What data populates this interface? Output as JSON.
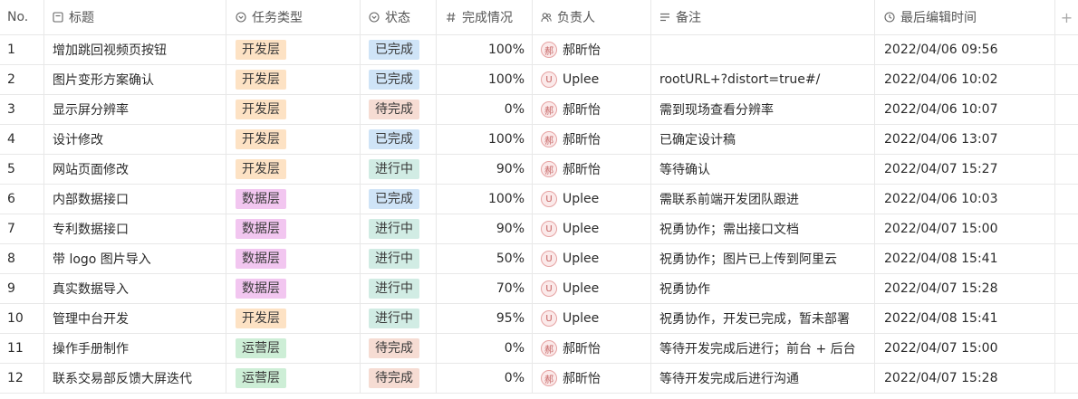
{
  "headers": {
    "no": "No.",
    "title": "标题",
    "type": "任务类型",
    "status": "状态",
    "progress": "完成情况",
    "owner": "负责人",
    "note": "备注",
    "time": "最后编辑时间",
    "add": "+"
  },
  "colors": {
    "dev_tag": "#fde2c4",
    "data_tag": "#f2c6f0",
    "ops_tag": "#cdeed6",
    "done_status": "#cfe4f7",
    "todo_status": "#f6dcd3",
    "progress_status": "#d1ece4"
  },
  "rows": [
    {
      "no": "1",
      "title": "增加跳回视频页按钮",
      "type": "开发层",
      "type_color": "#fde2c4",
      "status": "已完成",
      "status_color": "#cfe4f7",
      "progress": "100%",
      "avatar": "郝",
      "owner": "郝昕怡",
      "note": "",
      "time": "2022/04/06 09:56"
    },
    {
      "no": "2",
      "title": "图片变形方案确认",
      "type": "开发层",
      "type_color": "#fde2c4",
      "status": "已完成",
      "status_color": "#cfe4f7",
      "progress": "100%",
      "avatar": "U",
      "owner": "Uplee",
      "note": "rootURL+?distort=true#/",
      "time": "2022/04/06 10:02"
    },
    {
      "no": "3",
      "title": "显示屏分辨率",
      "type": "开发层",
      "type_color": "#fde2c4",
      "status": "待完成",
      "status_color": "#f6dcd3",
      "progress": "0%",
      "avatar": "郝",
      "owner": "郝昕怡",
      "note": "需到现场查看分辨率",
      "time": "2022/04/06 10:07"
    },
    {
      "no": "4",
      "title": "设计修改",
      "type": "开发层",
      "type_color": "#fde2c4",
      "status": "已完成",
      "status_color": "#cfe4f7",
      "progress": "100%",
      "avatar": "郝",
      "owner": "郝昕怡",
      "note": "已确定设计稿",
      "time": "2022/04/06 13:07"
    },
    {
      "no": "5",
      "title": "网站页面修改",
      "type": "开发层",
      "type_color": "#fde2c4",
      "status": "进行中",
      "status_color": "#d1ece4",
      "progress": "90%",
      "avatar": "郝",
      "owner": "郝昕怡",
      "note": "等待确认",
      "time": "2022/04/07 15:27"
    },
    {
      "no": "6",
      "title": "内部数据接口",
      "type": "数据层",
      "type_color": "#f2c6f0",
      "status": "已完成",
      "status_color": "#cfe4f7",
      "progress": "100%",
      "avatar": "U",
      "owner": "Uplee",
      "note": "需联系前端开发团队跟进",
      "time": "2022/04/06 10:03"
    },
    {
      "no": "7",
      "title": "专利数据接口",
      "type": "数据层",
      "type_color": "#f2c6f0",
      "status": "进行中",
      "status_color": "#d1ece4",
      "progress": "90%",
      "avatar": "U",
      "owner": "Uplee",
      "note": "祝勇协作；需出接口文档",
      "time": "2022/04/07 15:00"
    },
    {
      "no": "8",
      "title": "带 logo 图片导入",
      "type": "数据层",
      "type_color": "#f2c6f0",
      "status": "进行中",
      "status_color": "#d1ece4",
      "progress": "50%",
      "avatar": "U",
      "owner": "Uplee",
      "note": "祝勇协作；图片已上传到阿里云",
      "time": "2022/04/08 15:41"
    },
    {
      "no": "9",
      "title": "真实数据导入",
      "type": "数据层",
      "type_color": "#f2c6f0",
      "status": "进行中",
      "status_color": "#d1ece4",
      "progress": "70%",
      "avatar": "U",
      "owner": "Uplee",
      "note": "祝勇协作",
      "time": "2022/04/07 15:28"
    },
    {
      "no": "10",
      "title": "管理中台开发",
      "type": "开发层",
      "type_color": "#fde2c4",
      "status": "进行中",
      "status_color": "#d1ece4",
      "progress": "95%",
      "avatar": "U",
      "owner": "Uplee",
      "note": "祝勇协作，开发已完成，暂未部署",
      "time": "2022/04/08 15:41"
    },
    {
      "no": "11",
      "title": "操作手册制作",
      "type": "运营层",
      "type_color": "#cdeed6",
      "status": "待完成",
      "status_color": "#f6dcd3",
      "progress": "0%",
      "avatar": "郝",
      "owner": "郝昕怡",
      "note": "等待开发完成后进行；前台 + 后台",
      "time": "2022/04/07 15:00"
    },
    {
      "no": "12",
      "title": "联系交易部反馈大屏迭代",
      "type": "运营层",
      "type_color": "#cdeed6",
      "status": "待完成",
      "status_color": "#f6dcd3",
      "progress": "0%",
      "avatar": "郝",
      "owner": "郝昕怡",
      "note": "等待开发完成后进行沟通",
      "time": "2022/04/07 15:28"
    }
  ]
}
